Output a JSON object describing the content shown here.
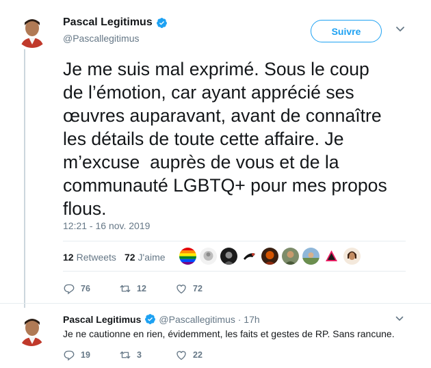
{
  "main_tweet": {
    "author_name": "Pascal Legitimus",
    "handle": "@Pascallegitimus",
    "follow_label": "Suivre",
    "text": "Je me suis mal exprimé. Sous le coup\nde l’émotion, car ayant apprécié ses\nœuvres auparavant, avant de connaître\nles détails de toute cette affaire. Je\nm’excuse  auprès de vous et de la\ncommunauté LGBTQ+ pour mes propos\nflous.",
    "timestamp": "12:21 - 16 nov. 2019",
    "retweets_count": "12",
    "retweets_label": "Retweets",
    "likes_count": "72",
    "likes_label": "J'aime",
    "reply_count": "76",
    "retweet_action_count": "12",
    "like_action_count": "72"
  },
  "reply_tweet": {
    "author_name": "Pascal Legitimus",
    "handle_time": "@Pascallegitimus · 17h",
    "text": "Je ne cautionne en rien, évidemment, les faits et gestes de RP. Sans rancune.",
    "reply_count": "19",
    "retweet_count": "3",
    "like_count": "22"
  },
  "colors": {
    "accent": "#1da1f2",
    "muted": "#657786",
    "text": "#14171a",
    "divider": "#e6ecf0"
  },
  "icons": [
    "verified-badge-icon",
    "chevron-down-icon",
    "reply-icon",
    "retweet-icon",
    "heart-icon"
  ]
}
